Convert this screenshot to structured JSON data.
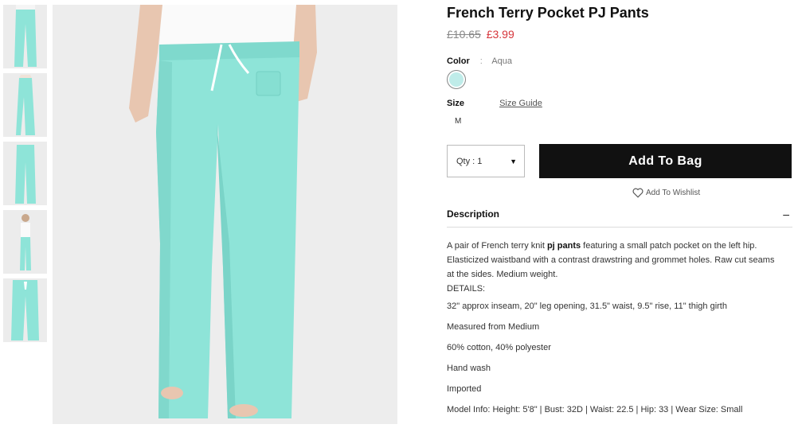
{
  "product": {
    "title": "French Terry Pocket PJ Pants",
    "price_old": "£10.65",
    "price_new": "£3.99"
  },
  "color": {
    "label": "Color",
    "separator": ":",
    "value": "Aqua",
    "swatch_color": "#bfece9"
  },
  "size": {
    "label": "Size",
    "guide_label": "Size Guide",
    "selected": "M"
  },
  "buy": {
    "qty_label": "Qty : 1",
    "add_to_bag_label": "Add To Bag",
    "wishlist_label": "Add To Wishlist"
  },
  "description": {
    "heading": "Description",
    "toggle": "–",
    "intro_before": "A pair of French terry knit ",
    "intro_bold": "pj pants",
    "intro_after": " featuring a small patch pocket on the left hip. Elasticized waistband with a contrast drawstring and grommet holes. Raw cut seams at the sides. Medium weight.",
    "details_label": "DETAILS:",
    "specs": [
      "32\" approx inseam, 20\" leg opening, 31.5\" waist, 9.5\" rise, 11\" thigh girth",
      "Measured from Medium",
      "60% cotton, 40% polyester",
      "Hand wash",
      "Imported",
      "Model Info: Height: 5'8\" | Bust: 32D | Waist: 22.5 | Hip: 33 | Wear Size: Small"
    ]
  },
  "colors": {
    "pants": "#8ee4d8",
    "background": "#ededed",
    "button": "#111111",
    "sale": "#d6353b"
  }
}
